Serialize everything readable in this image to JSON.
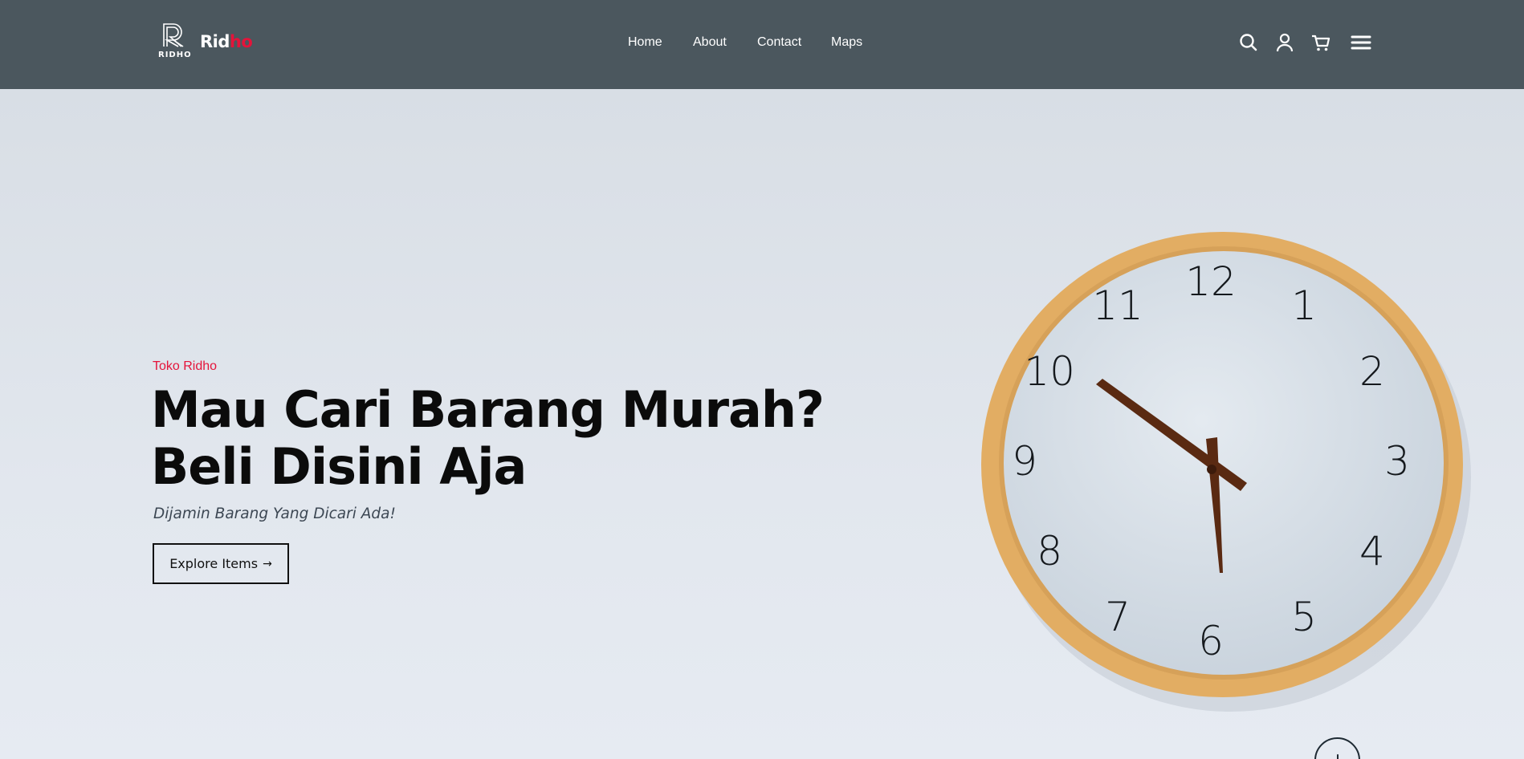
{
  "brand": {
    "wordmark_primary": "Rid",
    "wordmark_accent": "ho",
    "mark_caption": "RIDHO",
    "accent_color": "#e5133a",
    "navbar_color": "#4b575e"
  },
  "nav": {
    "links": [
      {
        "label": "Home"
      },
      {
        "label": "About"
      },
      {
        "label": "Contact"
      },
      {
        "label": "Maps"
      }
    ],
    "icons": [
      "search-icon",
      "user-icon",
      "cart-icon",
      "menu-icon"
    ]
  },
  "hero": {
    "eyebrow": "Toko Ridho",
    "headline_line1": "Mau Cari Barang Murah?",
    "headline_line2": "Beli Disini Aja",
    "subline": "Dijamin Barang Yang Dicari Ada!",
    "cta_label": "Explore Items",
    "cta_arrow": "→",
    "scroll_icon": "arrow-down-icon"
  },
  "clock": {
    "numerals": [
      "12",
      "1",
      "2",
      "3",
      "4",
      "5",
      "6",
      "7",
      "8",
      "9",
      "10",
      "11"
    ],
    "frame_color": "#e2ad63",
    "hand_color": "#5a2a12"
  }
}
